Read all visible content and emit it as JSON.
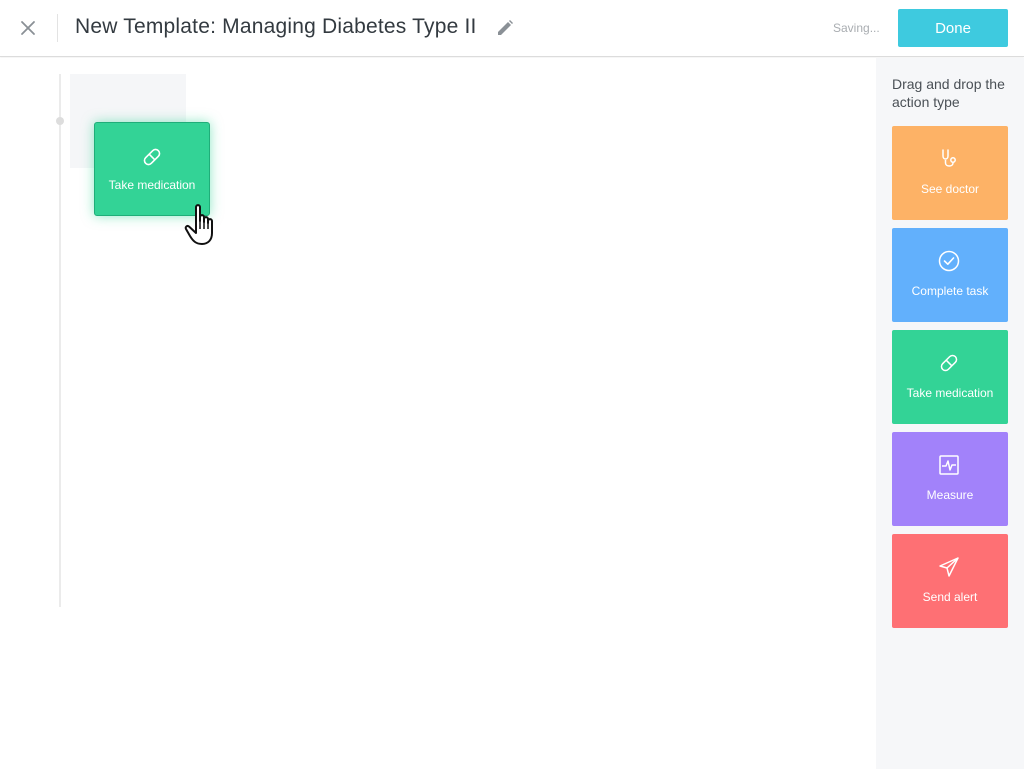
{
  "header": {
    "title": "New Template: Managing Diabetes Type II",
    "status": "Saving...",
    "done_label": "Done",
    "close_icon": "close-icon",
    "edit_icon": "pencil-icon"
  },
  "canvas": {
    "dragging_card": {
      "label": "Take medication",
      "icon": "pill-icon",
      "color": "#33d396"
    }
  },
  "sidebar": {
    "heading": "Drag and drop the action type",
    "actions": [
      {
        "label": "See doctor",
        "icon": "stethoscope-icon",
        "color": "#fdb266"
      },
      {
        "label": "Complete task",
        "icon": "check-circle-icon",
        "color": "#62b0fc"
      },
      {
        "label": "Take medication",
        "icon": "pill-icon",
        "color": "#33d396"
      },
      {
        "label": "Measure",
        "icon": "chart-measure-icon",
        "color": "#a282fa"
      },
      {
        "label": "Send alert",
        "icon": "paper-plane-icon",
        "color": "#fe7074"
      }
    ]
  }
}
